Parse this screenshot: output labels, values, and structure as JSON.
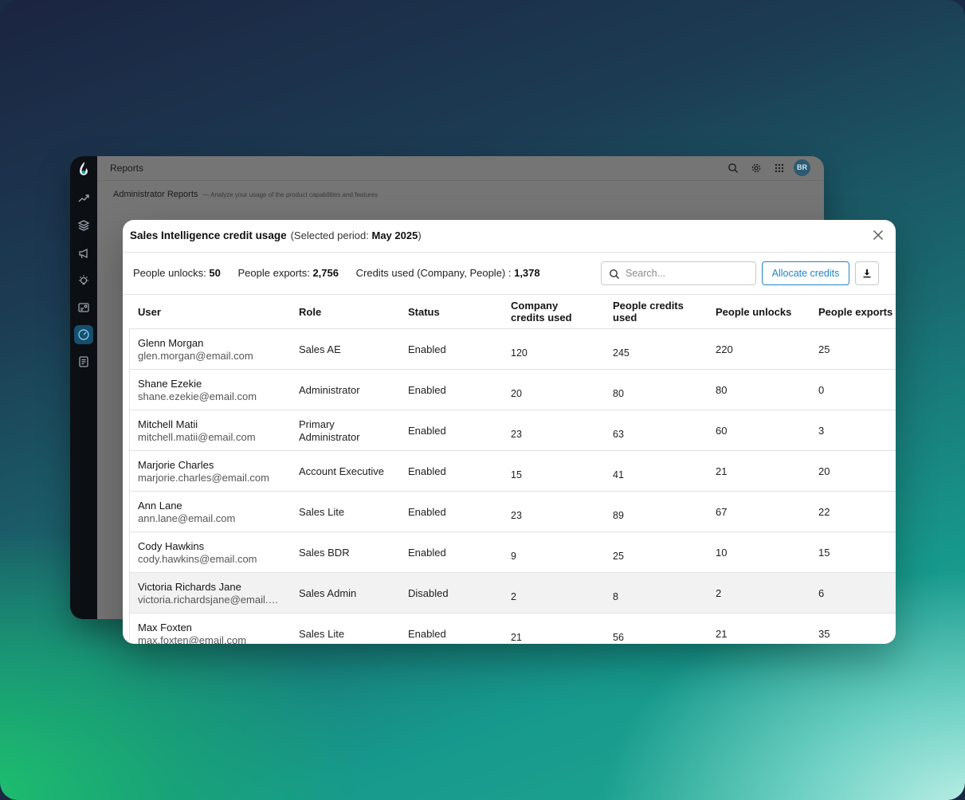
{
  "app": {
    "topbar_title": "Reports",
    "subheader_title": "Administrator Reports",
    "subheader_desc": "— Analyze your usage of the product capabilities and features",
    "avatar_initials": "BR"
  },
  "icons": {
    "rail": [
      "trend-icon",
      "layers-icon",
      "megaphone-icon",
      "lightbulb-icon",
      "contact-card-icon",
      "gauge-icon",
      "document-icon"
    ],
    "topbar": [
      "search-icon",
      "gear-icon",
      "apps-grid-icon"
    ]
  },
  "colors": {
    "accent": "#1f86c6",
    "rail_bg": "#0c1014",
    "rail_active": "#174f6e",
    "highlight_row": "#f3f2f2"
  },
  "modal": {
    "title": "Sales Intelligence credit usage",
    "period_prefix": "(Selected period: ",
    "period_value": "May 2025",
    "period_suffix": ")",
    "stats": {
      "people_unlocks_label": "People unlocks: ",
      "people_unlocks_value": "50",
      "people_exports_label": "People exports: ",
      "people_exports_value": "2,756",
      "credits_used_label": "Credits used (Company, People) : ",
      "credits_used_value": "1,378"
    },
    "search_placeholder": "Search...",
    "allocate_label": "Allocate credits"
  },
  "table": {
    "columns": {
      "user": "User",
      "role": "Role",
      "status": "Status",
      "company_credits": "Company credits used",
      "people_credits": "People credits used",
      "people_unlocks": "People unlocks",
      "people_exports": "People exports"
    },
    "rows": [
      {
        "name": "Glenn Morgan",
        "email": "glen.morgan@email.com",
        "role": "Sales AE",
        "status": "Enabled",
        "company_credits": "120",
        "people_credits": "245",
        "people_unlocks": "220",
        "people_exports": "25"
      },
      {
        "name": "Shane Ezekie",
        "email": "shane.ezekie@email.com",
        "role": "Administrator",
        "status": "Enabled",
        "company_credits": "20",
        "people_credits": "80",
        "people_unlocks": "80",
        "people_exports": "0"
      },
      {
        "name": "Mitchell Matii",
        "email": "mitchell.matii@email.com",
        "role": "Primary Administrator",
        "status": "Enabled",
        "company_credits": "23",
        "people_credits": "63",
        "people_unlocks": "60",
        "people_exports": "3"
      },
      {
        "name": "Marjorie Charles",
        "email": "marjorie.charles@email.com",
        "role": "Account Executive",
        "status": "Enabled",
        "company_credits": "15",
        "people_credits": "41",
        "people_unlocks": "21",
        "people_exports": "20"
      },
      {
        "name": "Ann Lane",
        "email": "ann.lane@email.com",
        "role": "Sales Lite",
        "status": "Enabled",
        "company_credits": "23",
        "people_credits": "89",
        "people_unlocks": "67",
        "people_exports": "22"
      },
      {
        "name": "Cody Hawkins",
        "email": "cody.hawkins@email.com",
        "role": "Sales BDR",
        "status": "Enabled",
        "company_credits": "9",
        "people_credits": "25",
        "people_unlocks": "10",
        "people_exports": "15"
      },
      {
        "name": "Victoria Richards Jane",
        "email": "victoria.richardsjane@email.com",
        "role": "Sales Admin",
        "status": "Disabled",
        "company_credits": "2",
        "people_credits": "8",
        "people_unlocks": "2",
        "people_exports": "6"
      },
      {
        "name": "Max Foxten",
        "email": "max.foxten@email.com",
        "role": "Sales Lite",
        "status": "Enabled",
        "company_credits": "21",
        "people_credits": "56",
        "people_unlocks": "21",
        "people_exports": "35"
      }
    ]
  }
}
